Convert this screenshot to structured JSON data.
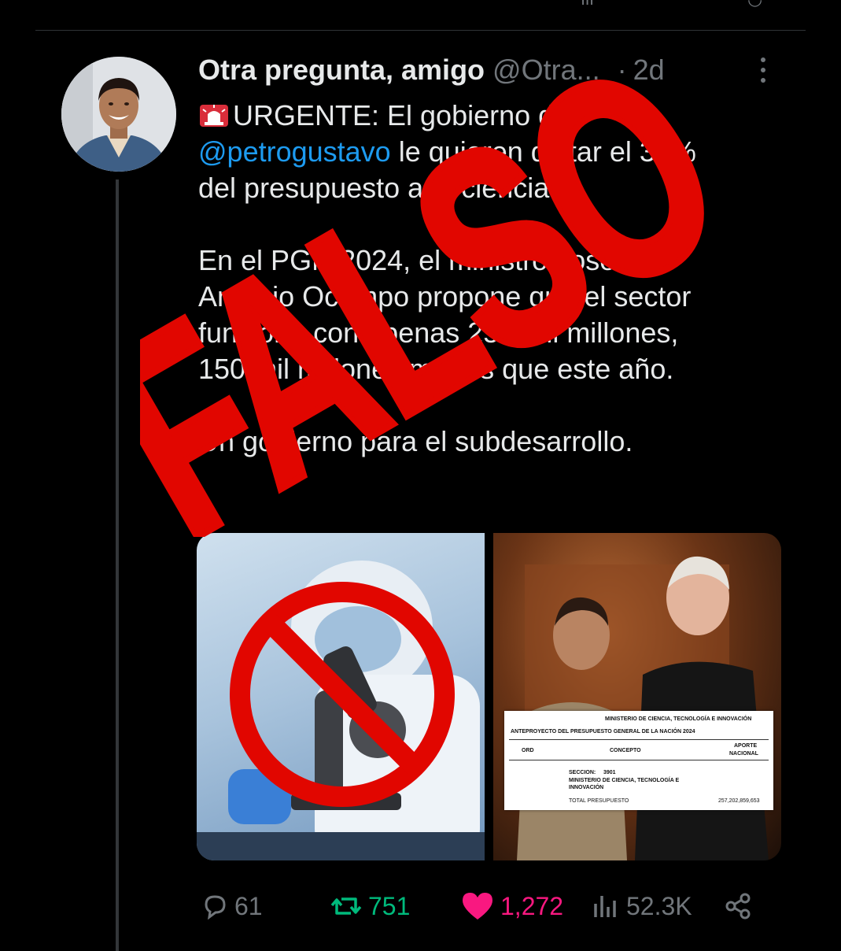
{
  "tweet": {
    "author_name": "Otra pregunta, amigo",
    "handle": "@Otra...",
    "separator": "·",
    "time": "2d",
    "lines": [
      {
        "prefix": "URGENTE: El gobierno de"
      },
      {
        "mention": "@petrogustavo",
        "rest": " le quieren quitar el 37%"
      },
      {
        "text": "del presupuesto a la ciencia."
      },
      {
        "text": ""
      },
      {
        "text": "En el PGN 2024, el ministro José"
      },
      {
        "text": "Antonio Ocampo propone que el sector"
      },
      {
        "text": "funcione con apenas 257 mil millones,"
      },
      {
        "text": "150 mil millones menos que este año."
      },
      {
        "text": ""
      },
      {
        "text": "Un gobierno para el subdesarrollo."
      }
    ]
  },
  "overlay_stamp": "FALSO",
  "document": {
    "ministry": "MINISTERIO DE CIENCIA, TECNOLOGÍA E INNOVACIÓN",
    "title": "ANTEPROYECTO DEL PRESUPUESTO GENERAL DE LA NACIÓN 2024",
    "col_ord": "ORD",
    "col_concepto": "CONCEPTO",
    "col_aporte": "APORTE",
    "col_nacional": "NACIONAL",
    "seccion_label": "SECCION:",
    "seccion_code": "3901",
    "entity_line1": "MINISTERIO DE CIENCIA, TECNOLOGÍA E",
    "entity_line2": "INNOVACIÓN",
    "total_label": "TOTAL PRESUPUESTO",
    "total_value": "257,202,859,653"
  },
  "actions": {
    "replies": "61",
    "reposts": "751",
    "likes": "1,272",
    "views": "52.3K"
  },
  "colors": {
    "background": "#000000",
    "text": "#e7e9ea",
    "muted": "#71767b",
    "link": "#1d9bf0",
    "repost": "#00ba7c",
    "like": "#f91880",
    "stamp": "#e10600"
  }
}
